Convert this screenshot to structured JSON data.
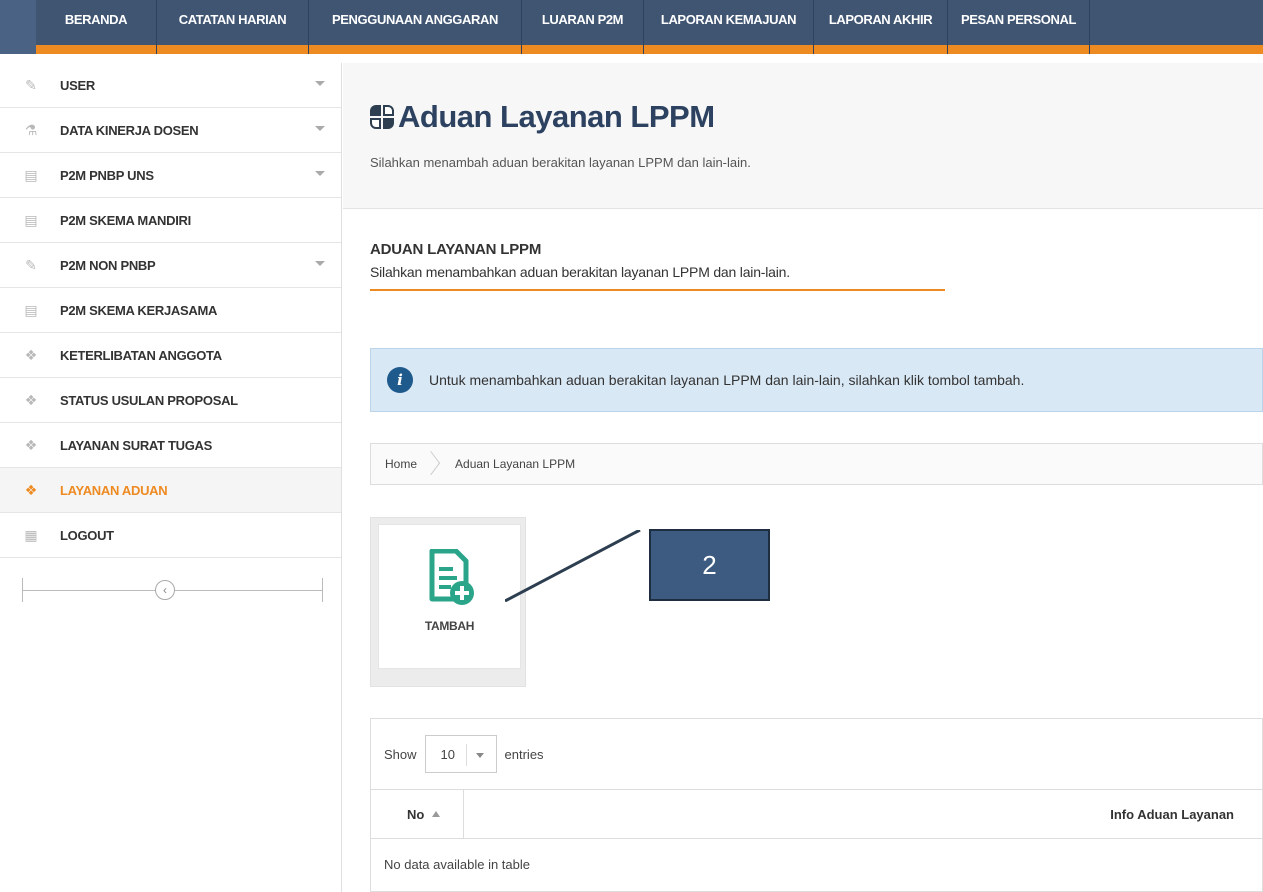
{
  "topnav": {
    "items": [
      {
        "label": "BERANDA",
        "width": 121
      },
      {
        "label": "CATATAN HARIAN",
        "width": 152
      },
      {
        "label": "PENGGUNAAN ANGGARAN",
        "width": 213
      },
      {
        "label": "LUARAN P2M",
        "width": 122
      },
      {
        "label": "LAPORAN KEMAJUAN",
        "width": 170
      },
      {
        "label": "LAPORAN AKHIR",
        "width": 134
      },
      {
        "label": "PESAN PERSONAL",
        "width": 142
      }
    ]
  },
  "sidebar": {
    "items": [
      {
        "label": "USER",
        "icon": "pencil-icon",
        "caret": true
      },
      {
        "label": "DATA KINERJA DOSEN",
        "icon": "flask-icon",
        "caret": true
      },
      {
        "label": "P2M PNBP UNS",
        "icon": "chart-icon",
        "caret": true
      },
      {
        "label": "P2M SKEMA MANDIRI",
        "icon": "chart-icon",
        "caret": false
      },
      {
        "label": "P2M NON PNBP",
        "icon": "pencil-icon",
        "caret": true
      },
      {
        "label": "P2M SKEMA KERJASAMA",
        "icon": "chart-icon",
        "caret": false
      },
      {
        "label": "KETERLIBATAN ANGGOTA",
        "icon": "dropbox-icon",
        "caret": false
      },
      {
        "label": "STATUS USULAN PROPOSAL",
        "icon": "dropbox-icon",
        "caret": false
      },
      {
        "label": "LAYANAN SURAT TUGAS",
        "icon": "dropbox-icon",
        "caret": false
      },
      {
        "label": "LAYANAN ADUAN",
        "icon": "dropbox-icon",
        "caret": false,
        "active": true
      },
      {
        "label": "LOGOUT",
        "icon": "grid-icon",
        "caret": false
      }
    ],
    "collapse_glyph": "‹"
  },
  "header": {
    "title": "Aduan Layanan LPPM",
    "subtitle": "Silahkan menambah aduan berakitan layanan LPPM dan lain-lain."
  },
  "section": {
    "title": "ADUAN LAYANAN LPPM",
    "subtitle": "Silahkan menambahkan aduan berakitan layanan LPPM dan lain-lain."
  },
  "alert": {
    "icon_glyph": "i",
    "text": "Untuk menambahkan aduan berakitan layanan LPPM dan lain-lain, silahkan klik tombol tambah."
  },
  "breadcrumb": {
    "home": "Home",
    "current": "Aduan Layanan LPPM"
  },
  "tambah": {
    "label": "TAMBAH"
  },
  "callout": {
    "number": "2"
  },
  "table": {
    "show_label": "Show",
    "entries_value": "10",
    "entries_label": "entries",
    "columns": [
      "No",
      "Info Aduan Layanan"
    ],
    "empty_text": "No data available in table"
  },
  "colors": {
    "nav_bg": "#3f5572",
    "accent_orange": "#ee8a22",
    "title_blue": "#2c4260",
    "alert_bg": "#d9e8f5",
    "icon_green": "#2aa58a",
    "callout_bg": "#3d5a80"
  }
}
